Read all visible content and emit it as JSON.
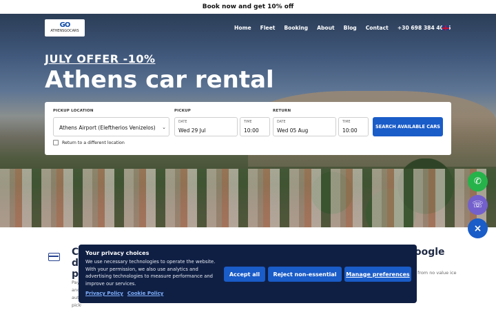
{
  "announcement": "Book now and get 10% off",
  "logo": {
    "mark": "GO",
    "text": "ATHENSGOCARS"
  },
  "nav": {
    "items": [
      "Home",
      "Fleet",
      "Booking",
      "About",
      "Blog",
      "Contact"
    ],
    "phone": "+30 698 384 4055",
    "language_icon": "uk-flag-icon"
  },
  "hero": {
    "offer": "JULY OFFER -10%",
    "headline": "Athens car rental"
  },
  "search": {
    "pickup_location_label": "PICKUP LOCATION",
    "pickup_location_value": "Athens Airport (Eleftherios Venizelos)",
    "pickup_label": "PICKUP",
    "return_label": "RETURN",
    "date_caption": "DATE",
    "time_caption": "TIME",
    "pickup_date": "Wed 29 Jul",
    "pickup_time": "10:00",
    "return_date": "Wed 05 Aug",
    "return_time": "10:00",
    "submit": "SEARCH AVAILABLE CARS",
    "different_location": "Return to a different location"
  },
  "features": {
    "left_title": "C d p",
    "left_text": "Pay and aut pickup.",
    "right_title": "oogle",
    "right_text": "from no value ice"
  },
  "cookie": {
    "title": "Your privacy choices",
    "body": "We use necessary technologies to operate the website. With your permission, we also use analytics and advertising technologies to measure performance and improve our services.",
    "privacy_link": "Privacy Policy",
    "cookie_link": "Cookie Policy",
    "accept": "Accept all",
    "reject": "Reject non-essential",
    "manage": "Manage preferences"
  },
  "colors": {
    "primary": "#1a5cc8",
    "cookie_bg": "#0f1f44",
    "whatsapp": "#25b34a",
    "viber": "#7360cc"
  }
}
